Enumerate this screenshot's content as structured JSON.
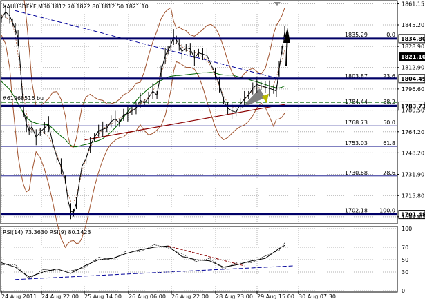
{
  "header": {
    "symbol_text": "XAUUSDFXF,M30  1812.70 1822.80 1812.50 1821.10",
    "indicator_text": "RSI(14) 73.3630 RSI(9) 80.1423",
    "order_label": "#61968516 bu"
  },
  "chart_data": [
    {
      "type": "line",
      "title": "XAUUSDFXF,M30",
      "ohlc_last": {
        "open": 1812.7,
        "high": 1822.8,
        "low": 1812.5,
        "close": 1821.1
      },
      "ylim": [
        1695,
        1863
      ],
      "y_ticks": [
        "1861.15",
        "1845.20",
        "1828.90",
        "1812.90",
        "1796.60",
        "1780.50",
        "1764.20",
        "1748.20",
        "1731.90",
        "1715.80",
        "1699.80"
      ],
      "x_ticks": [
        "24 Aug 2011",
        "24 Aug 22:00",
        "25 Aug 14:00",
        "26 Aug 06:00",
        "26 Aug 22:00",
        "28 Aug 23:00",
        "29 Aug 15:00",
        "30 Aug 07:30"
      ],
      "price_series": {
        "name": "XAUUSDFXF",
        "x": [
          0,
          6,
          12,
          16,
          20,
          24,
          28,
          32,
          36,
          40,
          44,
          50,
          56,
          62,
          68,
          74,
          80,
          86,
          92,
          96,
          100,
          104,
          108,
          112,
          116,
          122,
          128,
          134,
          140,
          146,
          152,
          158,
          164,
          170,
          176,
          182,
          188,
          194,
          200,
          206,
          212,
          218,
          224,
          230,
          236,
          240,
          244,
          248,
          252,
          256,
          260,
          266,
          272,
          278,
          284,
          290,
          296,
          302,
          308,
          314,
          320,
          326,
          332,
          338,
          344,
          350,
          356,
          362,
          368,
          374,
          380,
          386,
          392,
          396,
          400,
          404,
          408
        ],
        "y": [
          1850,
          1855,
          1852,
          1847,
          1842,
          1835,
          1810,
          1780,
          1770,
          1765,
          1768,
          1760,
          1764,
          1767,
          1770,
          1755,
          1745,
          1738,
          1728,
          1712,
          1704,
          1703,
          1710,
          1725,
          1738,
          1744,
          1754,
          1760,
          1765,
          1766,
          1767,
          1772,
          1774,
          1771,
          1777,
          1778,
          1780,
          1782,
          1788,
          1786,
          1790,
          1795,
          1792,
          1810,
          1822,
          1826,
          1830,
          1836,
          1834,
          1830,
          1825,
          1828,
          1827,
          1820,
          1824,
          1823,
          1822,
          1815,
          1808,
          1800,
          1788,
          1782,
          1780,
          1779,
          1785,
          1789,
          1792,
          1797,
          1800,
          1799,
          1798,
          1797,
          1796,
          1795,
          1812,
          1826,
          1840
        ]
      },
      "fib_levels": [
        {
          "label": "1835.29",
          "pct": "0.0",
          "value": 1835.29
        },
        {
          "label": "1803.87",
          "pct": "23.6",
          "value": 1803.87
        },
        {
          "label": "1784.44",
          "pct": "38.2",
          "value": 1784.44
        },
        {
          "label": "1768.73",
          "pct": "50.0",
          "value": 1768.73
        },
        {
          "label": "1753.03",
          "pct": "61.8",
          "value": 1753.03
        },
        {
          "label": "1730.68",
          "pct": "78.6",
          "value": 1730.68
        },
        {
          "label": "1702.18",
          "pct": "100.0",
          "value": 1702.18
        }
      ],
      "horizontal_levels": [
        {
          "label": "1834.80",
          "value": 1834.8
        },
        {
          "label": "1804.49",
          "value": 1804.49
        },
        {
          "label": "1783.73",
          "value": 1783.73
        },
        {
          "label": "1701.48",
          "value": 1701.48
        }
      ],
      "current_price": {
        "label": "1821.10",
        "value": 1821.1
      },
      "order_level": {
        "value": 1786.5
      }
    },
    {
      "type": "line",
      "title": "RSI(14) 73.3630 RSI(9) 80.1423",
      "ylim": [
        0,
        100
      ],
      "y_ticks": [
        "100",
        "70",
        "50",
        "30",
        "0"
      ],
      "series": [
        {
          "name": "RSI(14)",
          "x": [
            0,
            20,
            40,
            60,
            80,
            100,
            120,
            140,
            160,
            180,
            200,
            220,
            240,
            260,
            280,
            300,
            320,
            340,
            360,
            380,
            400,
            408
          ],
          "y": [
            45,
            38,
            22,
            30,
            35,
            28,
            40,
            50,
            52,
            60,
            66,
            70,
            72,
            55,
            50,
            48,
            38,
            42,
            48,
            52,
            68,
            73
          ]
        }
      ]
    }
  ],
  "colors": {
    "price": "#000000",
    "level": "#000066",
    "envelope": "#a0522d",
    "ma": "#006400",
    "trend_blue": "#000099",
    "trend_red": "#8b0000",
    "fib": "#000080",
    "current_price_bg": "#000000",
    "current_price_fg": "#ffffff"
  }
}
